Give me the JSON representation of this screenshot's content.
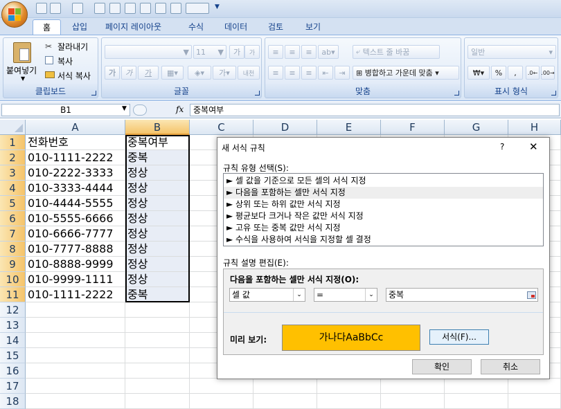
{
  "quick_access": {
    "dropdown": "▼"
  },
  "tabs": [
    "홈",
    "삽입",
    "페이지 레이아웃",
    "수식",
    "데이터",
    "검토",
    "보기"
  ],
  "ribbon": {
    "clipboard": {
      "paste": "붙여넣기",
      "cut": "잘라내기",
      "copy": "복사",
      "format_painter": "서식 복사",
      "label": "클립보드"
    },
    "font": {
      "size": "11",
      "bold": "가",
      "italic": "가",
      "underline": "가",
      "grow": "가",
      "shrink": "가",
      "phonetic": "내천",
      "label": "글꼴"
    },
    "alignment": {
      "wrap": "텍스트 줄 바꿈",
      "merge": "병합하고 가운데 맞춤",
      "label": "맞춤"
    },
    "number": {
      "format": "일반",
      "currency": "₩",
      "percent": "%",
      "comma": ",",
      "label": "표시 형식"
    }
  },
  "formula_bar": {
    "name_box": "B1",
    "fx": "fx",
    "content": "중복여부"
  },
  "columns": [
    "A",
    "B",
    "C",
    "D",
    "E",
    "F",
    "G",
    "H"
  ],
  "rows": [
    "1",
    "2",
    "3",
    "4",
    "5",
    "6",
    "7",
    "8",
    "9",
    "10",
    "11",
    "12",
    "13",
    "14",
    "15",
    "16",
    "17",
    "18"
  ],
  "cells": {
    "A": [
      "전화번호",
      "010-1111-2222",
      "010-2222-3333",
      "010-3333-4444",
      "010-4444-5555",
      "010-5555-6666",
      "010-6666-7777",
      "010-7777-8888",
      "010-8888-9999",
      "010-9999-1111",
      "010-1111-2222"
    ],
    "B": [
      "중복여부",
      "중복",
      "정상",
      "정상",
      "정상",
      "정상",
      "정상",
      "정상",
      "정상",
      "정상",
      "중복"
    ]
  },
  "dialog": {
    "title": "새 서식 규칙",
    "help": "?",
    "close": "✕",
    "rule_type_label": "규칙 유형 선택(S):",
    "rule_types": [
      "► 셀 값을 기준으로 모든 셀의 서식 지정",
      "► 다음을 포함하는 셀만 서식 지정",
      "► 상위 또는 하위 값만 서식 지정",
      "► 평균보다 크거나 작은 값만 서식 지정",
      "► 고유 또는 중복 값만 서식 지정",
      "► 수식을 사용하여 서식을 지정할 셀 결정"
    ],
    "edit_label": "규칙 설명 편집(E):",
    "edit_heading": "다음을 포함하는 셀만 서식 지정(O):",
    "condition_type": "셀 값",
    "operator": "=",
    "value": "중복",
    "preview_label": "미리 보기:",
    "preview_text": "가나다AaBbCc",
    "preview_color": "#FFC000",
    "format_button": "서식(F)...",
    "ok": "확인",
    "cancel": "취소"
  }
}
